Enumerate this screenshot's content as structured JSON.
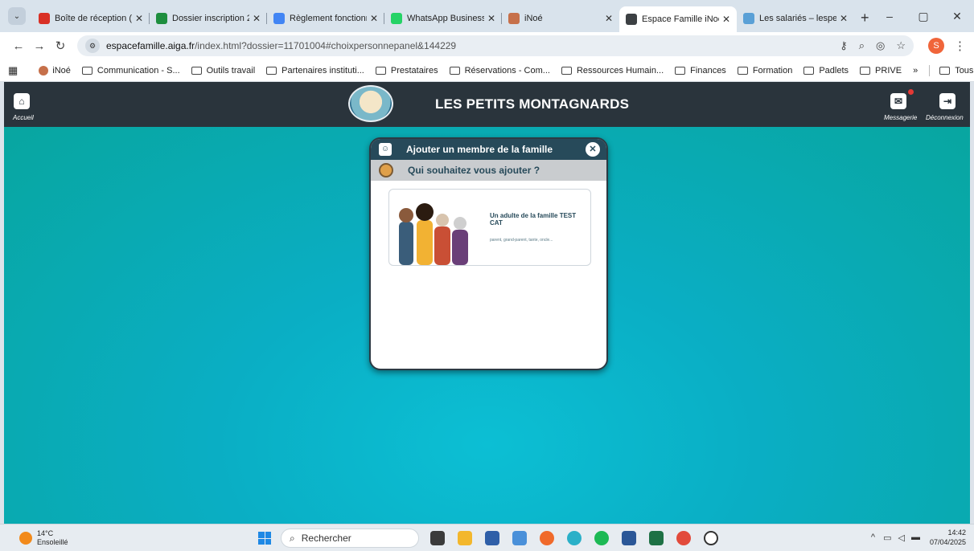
{
  "tabs": [
    {
      "title": "Boîte de réception (",
      "color": "#d93025",
      "active": false
    },
    {
      "title": "Dossier inscription 2",
      "color": "#1e8e3e",
      "active": false
    },
    {
      "title": "Règlement fonctionn",
      "color": "#4285f4",
      "active": false
    },
    {
      "title": "WhatsApp Business",
      "color": "#25d366",
      "active": false
    },
    {
      "title": "iNoé",
      "color": "#c6704a",
      "active": false
    },
    {
      "title": "Espace Famille iNoe",
      "color": "#3c4043",
      "active": true
    },
    {
      "title": "Les salariés – lespeti",
      "color": "#5aa0d6",
      "active": false
    }
  ],
  "address": {
    "host": "espacefamille.aiga.fr",
    "path": "/index.html?dossier=11701004#choixpersonnepanel&144229",
    "profile_initial": "S"
  },
  "bookmarks": [
    {
      "label": "iNoé",
      "type": "site"
    },
    {
      "label": "Communication - S...",
      "type": "folder"
    },
    {
      "label": "Outils travail",
      "type": "folder"
    },
    {
      "label": "Partenaires instituti...",
      "type": "folder"
    },
    {
      "label": "Prestataires",
      "type": "folder"
    },
    {
      "label": "Réservations - Com...",
      "type": "folder"
    },
    {
      "label": "Ressources Humain...",
      "type": "folder"
    },
    {
      "label": "Finances",
      "type": "folder"
    },
    {
      "label": "Formation",
      "type": "folder"
    },
    {
      "label": "Padlets",
      "type": "folder"
    },
    {
      "label": "PRIVE",
      "type": "folder"
    }
  ],
  "bookmarks_all": "Tous les favoris",
  "app": {
    "title": "LES PETITS MONTAGNARDS",
    "home_label": "Accueil",
    "messages_label": "Messagerie",
    "logout_label": "Déconnexion"
  },
  "modal": {
    "title": "Ajouter un membre de la famille",
    "subtitle": "Qui souhaitez vous ajouter ?",
    "card_title": "Un adulte de la famille TEST CAT",
    "card_desc": "parent, grand-parent, tante, oncle..."
  },
  "taskbar": {
    "temp": "14°C",
    "weather": "Ensoleillé",
    "search_placeholder": "Rechercher",
    "time": "14:42",
    "date": "07/04/2025"
  }
}
